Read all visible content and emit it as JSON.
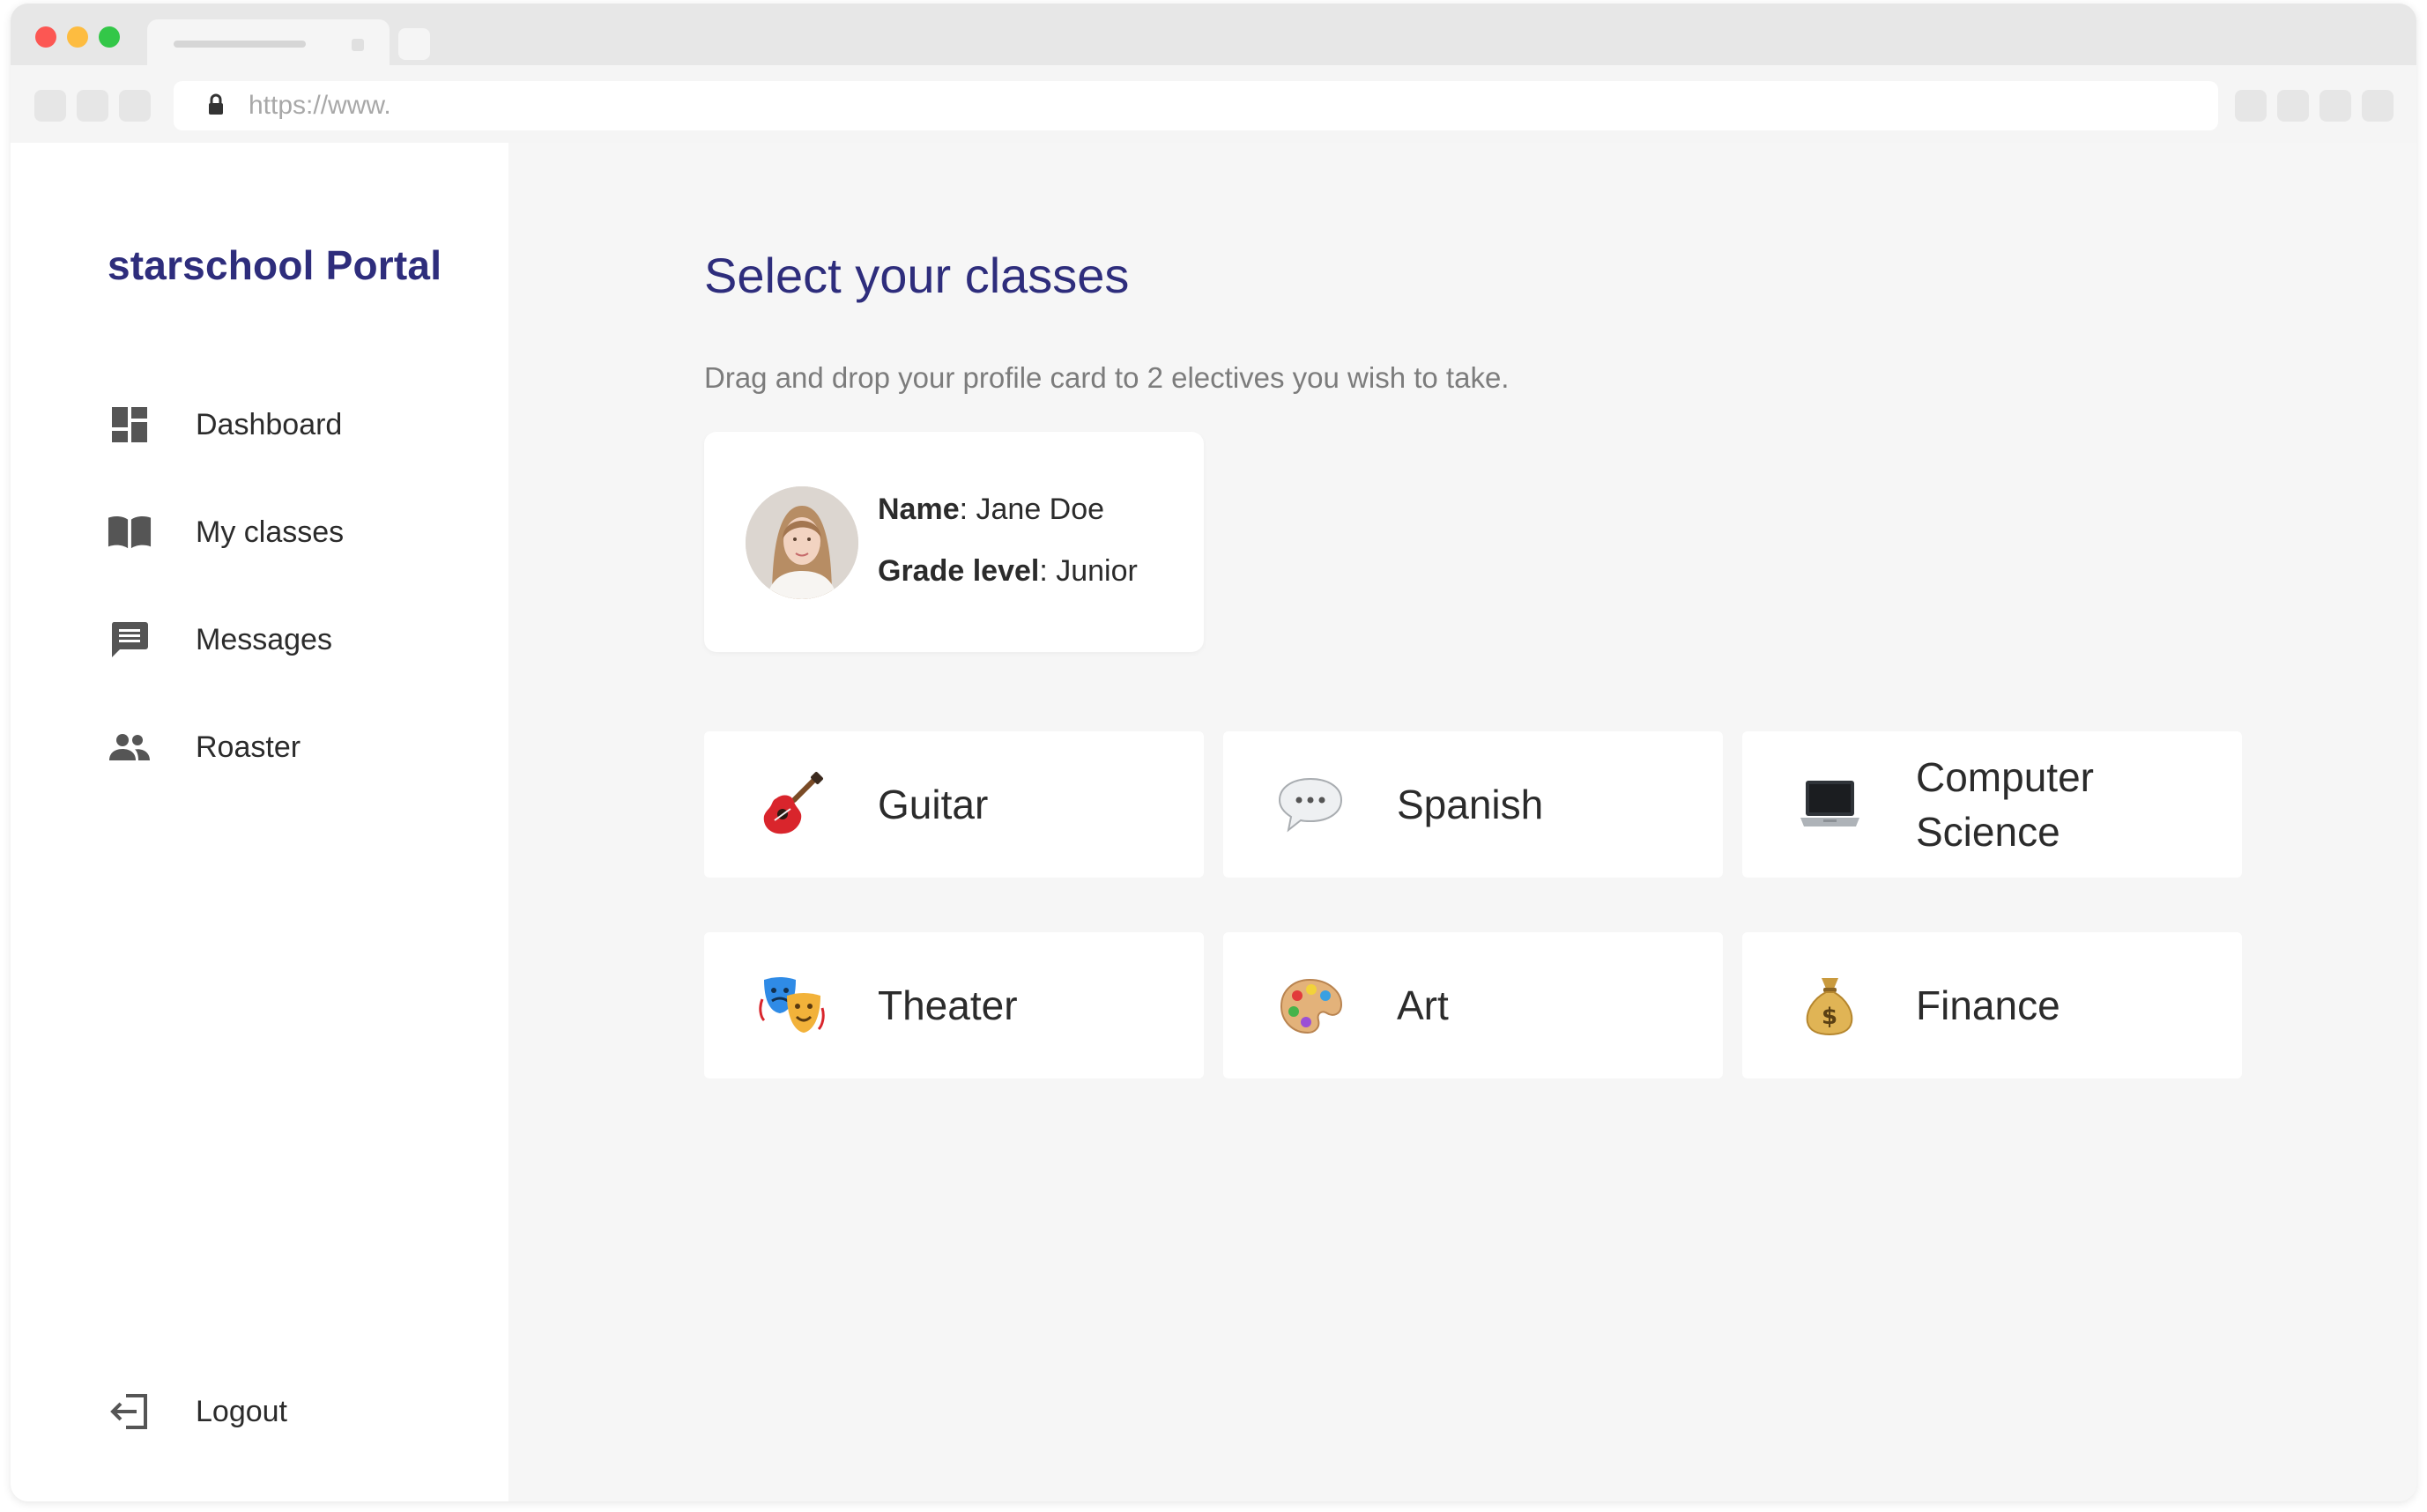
{
  "browser": {
    "url": "https://www."
  },
  "sidebar": {
    "brand": "starschool Portal",
    "items": [
      {
        "label": "Dashboard",
        "icon": "dashboard-icon"
      },
      {
        "label": "My classes",
        "icon": "book-icon"
      },
      {
        "label": "Messages",
        "icon": "message-icon"
      },
      {
        "label": "Roaster",
        "icon": "people-icon"
      }
    ],
    "logout": {
      "label": "Logout",
      "icon": "logout-icon"
    }
  },
  "main": {
    "title": "Select your classes",
    "subtitle": "Drag and drop your profile card to 2 electives you wish to take.",
    "profile": {
      "name_label": "Name",
      "name_value": ": Jane Doe",
      "grade_label": "Grade level",
      "grade_value": ": Junior"
    },
    "electives": [
      {
        "name": "Guitar",
        "icon": "guitar-icon"
      },
      {
        "name": "Spanish",
        "icon": "speech-bubble-icon"
      },
      {
        "name": "Computer Science",
        "icon": "laptop-icon"
      },
      {
        "name": "Theater",
        "icon": "theater-masks-icon"
      },
      {
        "name": "Art",
        "icon": "palette-icon"
      },
      {
        "name": "Finance",
        "icon": "money-bag-icon"
      }
    ]
  },
  "colors": {
    "brand": "#2e2d7c",
    "text": "#2b2b2b",
    "muted": "#7c7c7c",
    "background": "#f6f6f6",
    "icon": "#555555"
  }
}
